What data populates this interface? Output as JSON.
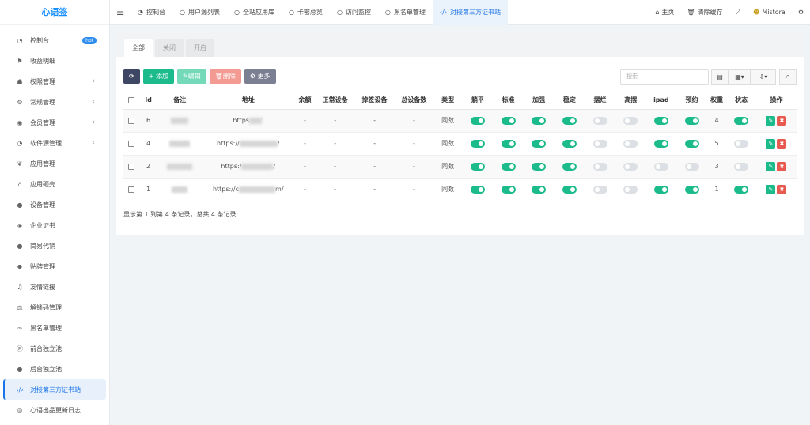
{
  "app_title": "心语签",
  "sidebar": {
    "items": [
      {
        "label": "控制台",
        "icon": "dashboard-icon",
        "glyph": "◔",
        "badge": "hot",
        "chevron": false
      },
      {
        "label": "收益明细",
        "icon": "flag-icon",
        "glyph": "⚑",
        "chevron": false
      },
      {
        "label": "权限管理",
        "icon": "users-icon",
        "glyph": "☗",
        "chevron": true
      },
      {
        "label": "常规管理",
        "icon": "cogs-icon",
        "glyph": "⚙",
        "chevron": true
      },
      {
        "label": "会员管理",
        "icon": "user-circle-icon",
        "glyph": "◉",
        "chevron": true
      },
      {
        "label": "软件源管理",
        "icon": "dashboard-icon",
        "glyph": "◔",
        "chevron": true
      },
      {
        "label": "应用管理",
        "icon": "leaf-icon",
        "glyph": "❦",
        "chevron": false
      },
      {
        "label": "应用砸壳",
        "icon": "home-icon",
        "glyph": "⌂",
        "chevron": false
      },
      {
        "label": "设备管理",
        "icon": "circle-icon",
        "glyph": "●",
        "chevron": false
      },
      {
        "label": "企业证书",
        "icon": "diamond-icon",
        "glyph": "◈",
        "chevron": false
      },
      {
        "label": "简易代销",
        "icon": "comment-icon",
        "glyph": "●",
        "chevron": false
      },
      {
        "label": "贴牌管理",
        "icon": "tags-icon",
        "glyph": "◆",
        "chevron": false
      },
      {
        "label": "友情链接",
        "icon": "music-icon",
        "glyph": "♫",
        "chevron": false
      },
      {
        "label": "解锁码管理",
        "icon": "balance-scale-icon",
        "glyph": "⚖",
        "chevron": false
      },
      {
        "label": "黑名单管理",
        "icon": "bicycle-icon",
        "glyph": "∞",
        "chevron": false
      },
      {
        "label": "前台独立池",
        "icon": "product-hunt-icon",
        "glyph": "Ⓟ",
        "chevron": false
      },
      {
        "label": "后台独立池",
        "icon": "apple-icon",
        "glyph": "●",
        "chevron": false
      },
      {
        "label": "对接第三方证书站",
        "icon": "code-icon",
        "glyph": "‹/›",
        "chevron": false,
        "active": true
      },
      {
        "label": "心语出品更新日志",
        "icon": "eye-icon",
        "glyph": "◎",
        "chevron": false
      }
    ]
  },
  "topbar": {
    "tabs": [
      {
        "label": "控制台",
        "icon": "dashboard-icon",
        "glyph": "◔"
      },
      {
        "label": "用户源列表",
        "icon": "circle-o-icon",
        "glyph": "○"
      },
      {
        "label": "全站应用库",
        "icon": "circle-o-icon",
        "glyph": "○"
      },
      {
        "label": "卡密总览",
        "icon": "circle-o-icon",
        "glyph": "○"
      },
      {
        "label": "访问监控",
        "icon": "circle-o-icon",
        "glyph": "○"
      },
      {
        "label": "黑名单管理",
        "icon": "circle-o-icon",
        "glyph": "○"
      },
      {
        "label": "对接第三方证书站",
        "icon": "code-icon",
        "glyph": "‹/›",
        "active": true
      }
    ],
    "home_label": "主页",
    "clear_cache_label": "清除缓存",
    "username": "Mistora"
  },
  "panel": {
    "filter_tabs": [
      "全部",
      "关闭",
      "开启"
    ],
    "toolbar": {
      "add": "添加",
      "edit": "编辑",
      "delete": "删除",
      "more": "更多"
    },
    "search_placeholder": "搜索",
    "columns": [
      "Id",
      "备注",
      "地址",
      "余额",
      "正常设备",
      "掉签设备",
      "总设备数",
      "类型",
      "躺平",
      "标准",
      "加强",
      "稳定",
      "摆烂",
      "高摆",
      "ipad",
      "预约",
      "权重",
      "状态",
      "操作"
    ],
    "rows": [
      {
        "id": "6",
        "url_prefix": "https",
        "url_suffix": "'",
        "balance": "-",
        "normal": "-",
        "dropped": "-",
        "total": "-",
        "type": "同数",
        "switches": [
          true,
          true,
          true,
          true,
          false,
          false,
          true,
          true
        ],
        "weight": "4",
        "status": true
      },
      {
        "id": "4",
        "url_prefix": "https://",
        "url_suffix": "/",
        "balance": "-",
        "normal": "-",
        "dropped": "-",
        "total": "-",
        "type": "同数",
        "switches": [
          true,
          true,
          true,
          true,
          false,
          false,
          true,
          true
        ],
        "weight": "5",
        "status": false
      },
      {
        "id": "2",
        "url_prefix": "https:/",
        "url_suffix": "/",
        "balance": "-",
        "normal": "-",
        "dropped": "-",
        "total": "-",
        "type": "同数",
        "switches": [
          true,
          true,
          true,
          true,
          false,
          false,
          false,
          false
        ],
        "weight": "3",
        "status": false
      },
      {
        "id": "1",
        "url_prefix": "https://c",
        "url_suffix": "m/",
        "balance": "-",
        "normal": "-",
        "dropped": "-",
        "total": "-",
        "type": "同数",
        "switches": [
          true,
          true,
          true,
          true,
          false,
          false,
          true,
          true
        ],
        "weight": "1",
        "status": true
      }
    ],
    "footer": "显示第 1 到第 4 条记录，总共 4 条记录"
  }
}
